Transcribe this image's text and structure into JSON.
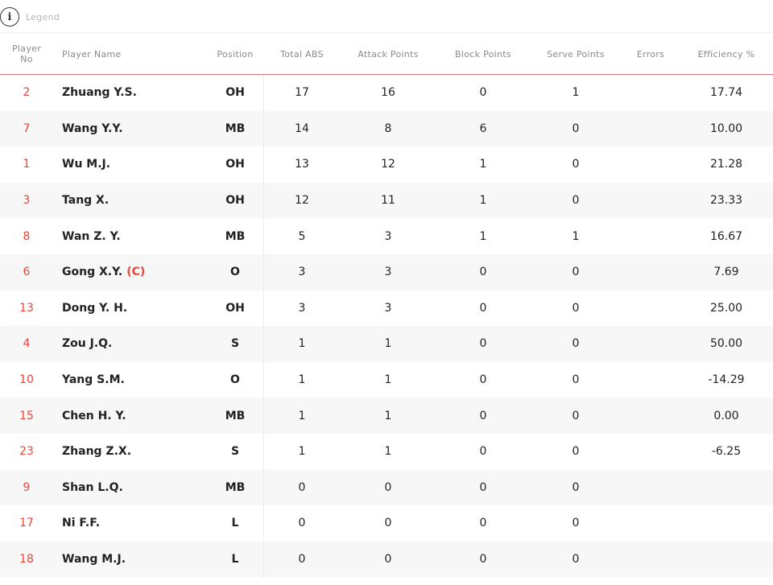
{
  "legend": {
    "label": "Legend",
    "icon": "info-icon"
  },
  "columns": {
    "player_no": "Player No",
    "player_name": "Player Name",
    "position": "Position",
    "total_abs": "Total ABS",
    "attack_points": "Attack Points",
    "block_points": "Block Points",
    "serve_points": "Serve Points",
    "errors": "Errors",
    "efficiency": "Efficiency %"
  },
  "colors": {
    "accent": "#e8473a",
    "header_rule": "#e4737b",
    "row_alt": "#f7f7f7"
  },
  "rows": [
    {
      "no": "2",
      "name": "Zhuang Y.S.",
      "captain": "",
      "pos": "OH",
      "abs": "17",
      "att": "16",
      "blk": "0",
      "srv": "1",
      "err": "",
      "eff": "17.74"
    },
    {
      "no": "7",
      "name": "Wang Y.Y.",
      "captain": "",
      "pos": "MB",
      "abs": "14",
      "att": "8",
      "blk": "6",
      "srv": "0",
      "err": "",
      "eff": "10.00"
    },
    {
      "no": "1",
      "name": "Wu M.J.",
      "captain": "",
      "pos": "OH",
      "abs": "13",
      "att": "12",
      "blk": "1",
      "srv": "0",
      "err": "",
      "eff": "21.28"
    },
    {
      "no": "3",
      "name": "Tang X.",
      "captain": "",
      "pos": "OH",
      "abs": "12",
      "att": "11",
      "blk": "1",
      "srv": "0",
      "err": "",
      "eff": "23.33"
    },
    {
      "no": "8",
      "name": "Wan Z. Y.",
      "captain": "",
      "pos": "MB",
      "abs": "5",
      "att": "3",
      "blk": "1",
      "srv": "1",
      "err": "",
      "eff": "16.67"
    },
    {
      "no": "6",
      "name": "Gong X.Y.",
      "captain": "(C)",
      "pos": "O",
      "abs": "3",
      "att": "3",
      "blk": "0",
      "srv": "0",
      "err": "",
      "eff": "7.69"
    },
    {
      "no": "13",
      "name": "Dong Y. H.",
      "captain": "",
      "pos": "OH",
      "abs": "3",
      "att": "3",
      "blk": "0",
      "srv": "0",
      "err": "",
      "eff": "25.00"
    },
    {
      "no": "4",
      "name": "Zou J.Q.",
      "captain": "",
      "pos": "S",
      "abs": "1",
      "att": "1",
      "blk": "0",
      "srv": "0",
      "err": "",
      "eff": "50.00"
    },
    {
      "no": "10",
      "name": "Yang S.M.",
      "captain": "",
      "pos": "O",
      "abs": "1",
      "att": "1",
      "blk": "0",
      "srv": "0",
      "err": "",
      "eff": "-14.29"
    },
    {
      "no": "15",
      "name": "Chen H. Y.",
      "captain": "",
      "pos": "MB",
      "abs": "1",
      "att": "1",
      "blk": "0",
      "srv": "0",
      "err": "",
      "eff": "0.00"
    },
    {
      "no": "23",
      "name": "Zhang Z.X.",
      "captain": "",
      "pos": "S",
      "abs": "1",
      "att": "1",
      "blk": "0",
      "srv": "0",
      "err": "",
      "eff": "-6.25"
    },
    {
      "no": "9",
      "name": "Shan L.Q.",
      "captain": "",
      "pos": "MB",
      "abs": "0",
      "att": "0",
      "blk": "0",
      "srv": "0",
      "err": "",
      "eff": ""
    },
    {
      "no": "17",
      "name": "Ni F.F.",
      "captain": "",
      "pos": "L",
      "abs": "0",
      "att": "0",
      "blk": "0",
      "srv": "0",
      "err": "",
      "eff": ""
    },
    {
      "no": "18",
      "name": "Wang M.J.",
      "captain": "",
      "pos": "L",
      "abs": "0",
      "att": "0",
      "blk": "0",
      "srv": "0",
      "err": "",
      "eff": ""
    }
  ]
}
